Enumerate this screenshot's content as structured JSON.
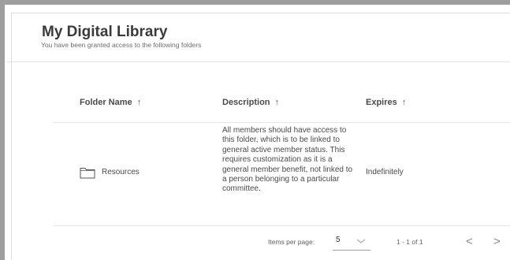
{
  "page": {
    "title": "My Digital Library",
    "subtitle": "You have been granted access to the following folders"
  },
  "table": {
    "columns": [
      {
        "label": "Folder Name",
        "sort_icon": "↑"
      },
      {
        "label": "Description",
        "sort_icon": "↑"
      },
      {
        "label": "Expires",
        "sort_icon": "↑"
      }
    ],
    "rows": [
      {
        "folder_icon": "folder-icon",
        "name": "Resources",
        "description": "All members should have access to this folder, which is to be linked to general active member status. This requires customization as it is a general member benefit, not linked to a person belonging to a particular committee.",
        "expires": "Indefinitely"
      }
    ]
  },
  "paginator": {
    "items_per_page_label": "Items per page:",
    "page_size": "5",
    "range_label": "1 - 1 of 1",
    "prev_icon": "<",
    "next_icon": ">"
  }
}
